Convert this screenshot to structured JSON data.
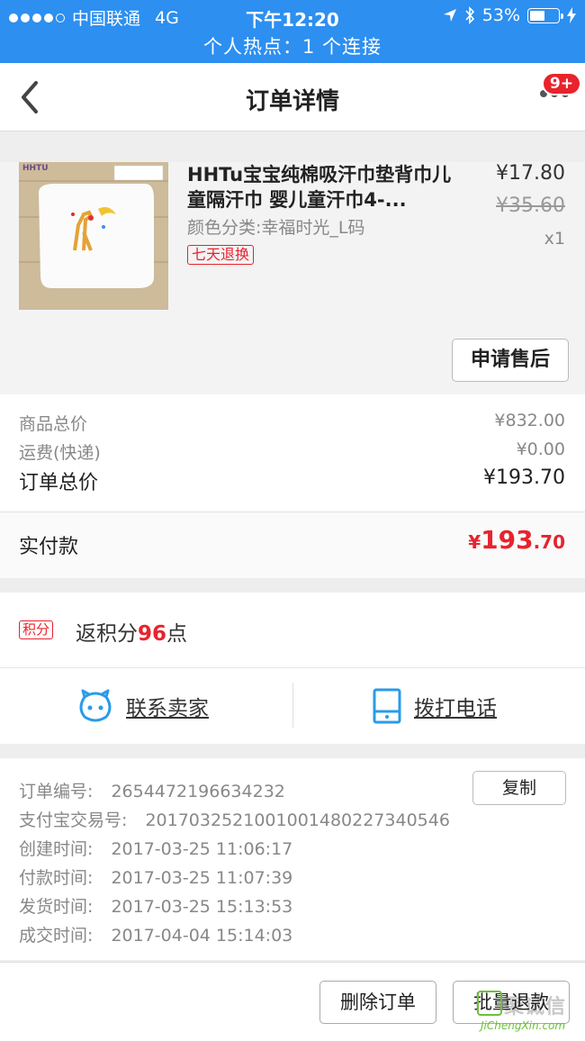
{
  "status_bar": {
    "carrier": "中国联通",
    "network": "4G",
    "time": "下午12:20",
    "battery_percent": "53%",
    "battery_level": 0.53,
    "hotspot": "个人热点：1 个连接"
  },
  "navbar": {
    "title": "订单详情",
    "badge": "9+"
  },
  "product": {
    "title": "HHTu宝宝纯棉吸汗巾垫背巾儿童隔汗巾 婴儿童汗巾4-...",
    "sku": "颜色分类:幸福时光_L码",
    "tag": "七天退换",
    "price": "¥17.80",
    "original_price": "¥35.60",
    "quantity": "x1",
    "image_brand": "HHTU",
    "after_sale_label": "申请售后"
  },
  "summary": {
    "goods_total_label": "商品总价",
    "goods_total": "¥832.00",
    "shipping_label": "运费(快递)",
    "shipping": "¥0.00",
    "order_total_label": "订单总价",
    "order_total": "¥193.70",
    "paid_label": "实付款",
    "paid_currency": "¥",
    "paid_int": "193",
    "paid_dec": ".70"
  },
  "points": {
    "tag": "积分",
    "prefix": "返积分",
    "value": "96",
    "suffix": "点"
  },
  "contact": {
    "seller_label": "联系卖家",
    "phone_label": "拨打电话"
  },
  "order_info": {
    "order_no_label": "订单编号:",
    "order_no": "2654472196634232",
    "copy_label": "复制",
    "alipay_label": "支付宝交易号:",
    "alipay_no": "2017032521001001480227340546",
    "created_label": "创建时间:",
    "created": "2017-03-25 11:06:17",
    "paid_label": "付款时间:",
    "paid": "2017-03-25 11:07:39",
    "shipped_label": "发货时间:",
    "shipped": "2017-03-25 15:13:53",
    "completed_label": "成交时间:",
    "completed": "2017-04-04 15:14:03"
  },
  "actions": {
    "delete_label": "删除订单",
    "refund_label": "批量退款"
  },
  "watermark": {
    "text": "聚诚信",
    "url": "JiChengXin.com"
  },
  "colors": {
    "status_bar": "#2d8ff0",
    "accent_red": "#e8232c",
    "icon_blue": "#2a9be8",
    "watermark_green": "#6fbf3a"
  }
}
